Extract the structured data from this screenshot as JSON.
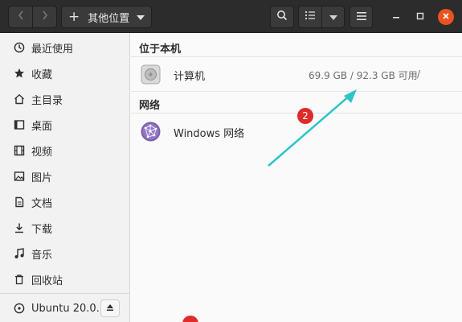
{
  "header": {
    "path_label": "其他位置"
  },
  "sidebar": {
    "items": [
      {
        "label": "最近使用",
        "icon": "clock-icon"
      },
      {
        "label": "收藏",
        "icon": "star-icon"
      },
      {
        "label": "主目录",
        "icon": "home-icon"
      },
      {
        "label": "桌面",
        "icon": "desktop-icon"
      },
      {
        "label": "视频",
        "icon": "video-icon"
      },
      {
        "label": "图片",
        "icon": "image-icon"
      },
      {
        "label": "文档",
        "icon": "document-icon"
      },
      {
        "label": "下载",
        "icon": "download-icon"
      },
      {
        "label": "音乐",
        "icon": "music-icon"
      },
      {
        "label": "回收站",
        "icon": "trash-icon"
      }
    ],
    "drive": {
      "label": "Ubuntu 20.0…",
      "icon": "disc-icon"
    }
  },
  "main": {
    "local_header": "位于本机",
    "computer": {
      "label": "计算机",
      "info": "69.9 GB / 92.3 GB 可用",
      "mount": "/"
    },
    "network_header": "网络",
    "network": {
      "label": "Windows 网络"
    }
  },
  "annotations": {
    "badge_2": "2"
  },
  "colors": {
    "headerbar": "#2c2c2c",
    "close_button": "#e9541e",
    "annotation_badge": "#e02b2b",
    "annotation_arrow": "#2ec4c8"
  }
}
